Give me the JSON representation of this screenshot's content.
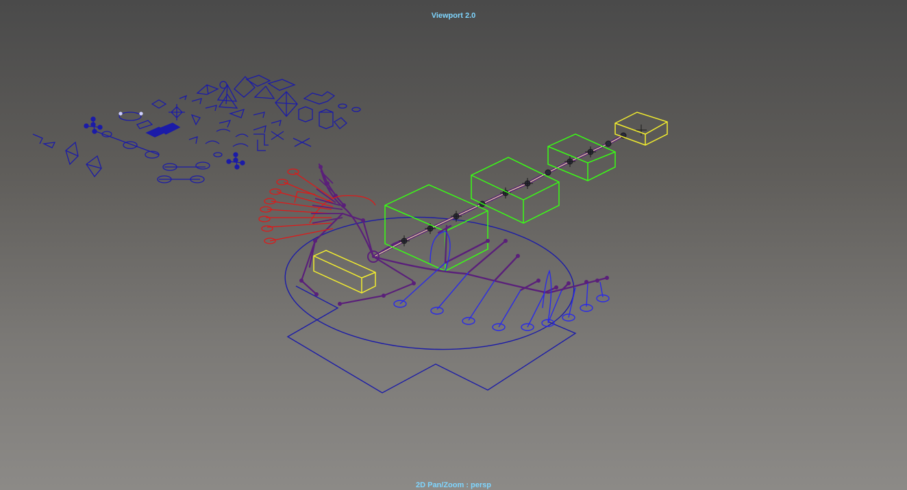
{
  "viewport": {
    "renderer_label": "Viewport 2.0",
    "camera_label": "2D Pan/Zoom : persp"
  },
  "colors": {
    "hud_text": "#7fd6ff",
    "controls_blue": "#1b1ba8",
    "controls_bright_blue": "#2a2ae8",
    "controls_red": "#e01818",
    "joints_purple": "#5a1f7a",
    "fk_box_green": "#39ff14",
    "ik_box_yellow": "#f3ee2e",
    "spine_highlight": "#f2e6a0"
  },
  "icons": [
    "transform-control-icon",
    "joint-icon",
    "locator-icon"
  ]
}
